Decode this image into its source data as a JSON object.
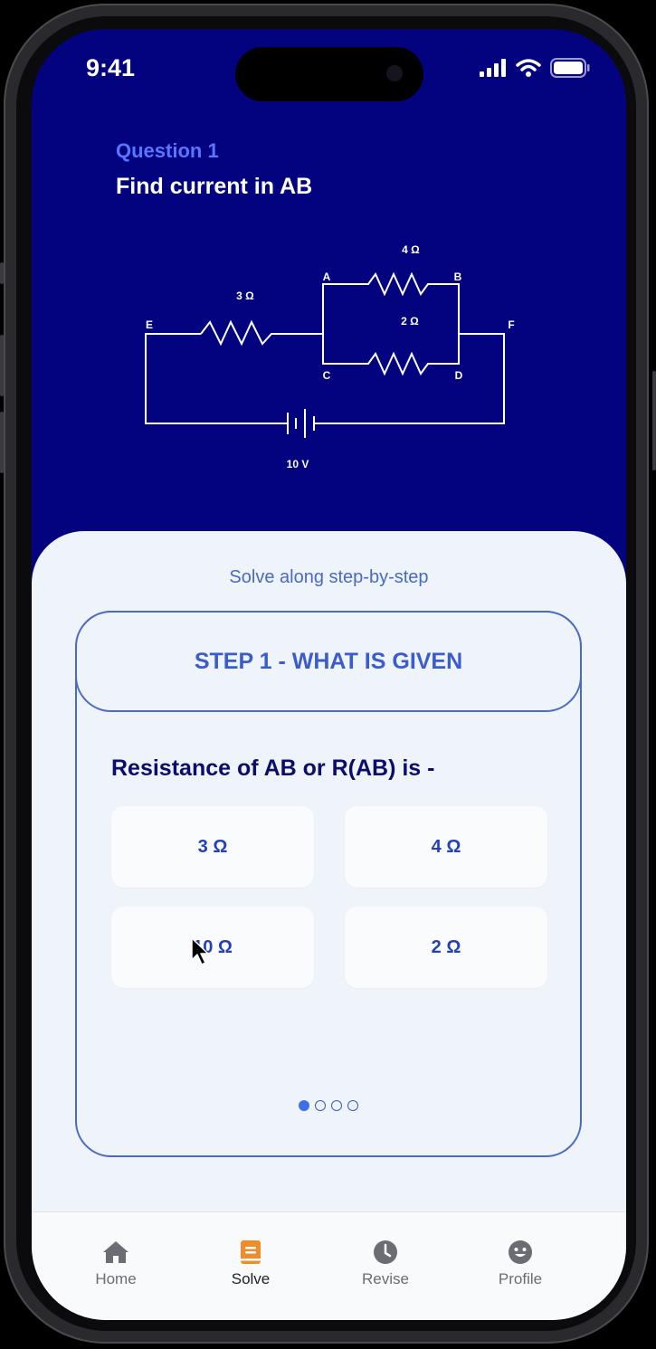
{
  "status_bar": {
    "time": "9:41"
  },
  "question": {
    "label": "Question 1",
    "title": "Find current in AB"
  },
  "circuit": {
    "resistors": [
      "4 Ω",
      "3 Ω",
      "2 Ω"
    ],
    "nodes": [
      "A",
      "B",
      "C",
      "D",
      "E",
      "F"
    ],
    "battery": "10 V"
  },
  "panel": {
    "hint": "Solve along step-by-step",
    "step_header": "STEP 1 - WHAT IS GIVEN",
    "question": "Resistance of AB or R(AB) is -",
    "options": [
      "3 Ω",
      "4 Ω",
      "10 Ω",
      "2 Ω"
    ],
    "step_index": 1,
    "step_total": 4
  },
  "tabs": [
    {
      "label": "Home",
      "icon": "home-icon"
    },
    {
      "label": "Solve",
      "icon": "book-icon",
      "active": true
    },
    {
      "label": "Revise",
      "icon": "clock-icon"
    },
    {
      "label": "Profile",
      "icon": "smiley-icon"
    }
  ],
  "colors": {
    "header_bg": "#03037f",
    "accent": "#3a5ccc",
    "active_tab": "#f28c28",
    "panel_bg": "#eef4fa"
  }
}
